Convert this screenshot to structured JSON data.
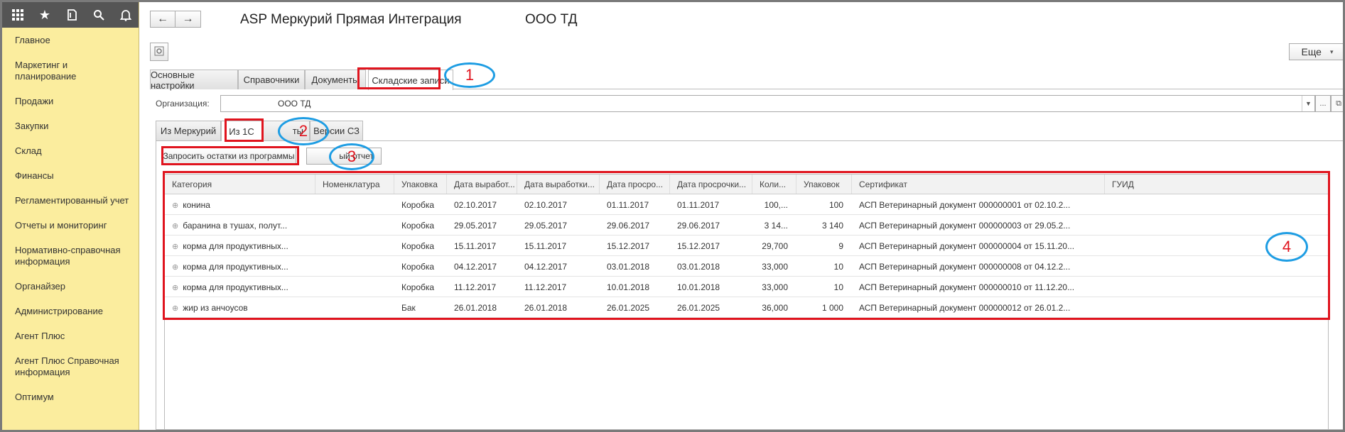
{
  "sidebar": {
    "top_icons": [
      "apps-grid-icon",
      "star-icon",
      "history-icon",
      "search-icon",
      "bell-icon"
    ],
    "items": [
      {
        "label": "Главное"
      },
      {
        "label": "Маркетинг и планирование"
      },
      {
        "label": "Продажи"
      },
      {
        "label": "Закупки"
      },
      {
        "label": "Склад"
      },
      {
        "label": "Финансы"
      },
      {
        "label": "Регламентированный учет"
      },
      {
        "label": "Отчеты и мониторинг"
      },
      {
        "label": "Нормативно-справочная информация"
      },
      {
        "label": "Органайзер"
      },
      {
        "label": "Администрирование"
      },
      {
        "label": "Агент Плюс"
      },
      {
        "label": "Агент Плюс Справочная информация"
      },
      {
        "label": "Оптимум"
      }
    ]
  },
  "header": {
    "title": "ASP Меркурий Прямая Интеграция",
    "org_title": "ООО ТД",
    "more_label": "Еще"
  },
  "tabs_main": [
    {
      "label": "Основные настройки"
    },
    {
      "label": "Справочники"
    },
    {
      "label": "Документы"
    },
    {
      "label": "Складские записи"
    }
  ],
  "org": {
    "label": "Организация:",
    "value": "ООО ТД"
  },
  "tabs_sub": [
    {
      "label": "Из Меркурий"
    },
    {
      "label": "Из 1С"
    },
    {
      "label": "ты"
    },
    {
      "label": "Версии СЗ"
    }
  ],
  "actions": {
    "request_label": "Запросить остатки из программы",
    "report_label": "ый отчет"
  },
  "table": {
    "columns": [
      "Категория",
      "Номенклатура",
      "Упаковка",
      "Дата выработ...",
      "Дата выработки...",
      "Дата просро...",
      "Дата просрочки...",
      "Коли...",
      "Упаковок",
      "Сертификат",
      "ГУИД"
    ],
    "rows": [
      [
        "конина",
        "",
        "Коробка",
        "02.10.2017",
        "02.10.2017",
        "01.11.2017",
        "01.11.2017",
        "100,...",
        "100",
        "АСП Ветеринарный документ 000000001 от 02.10.2...",
        ""
      ],
      [
        "баранина в тушах, полут...",
        "",
        "Коробка",
        "29.05.2017",
        "29.05.2017",
        "29.06.2017",
        "29.06.2017",
        "3 14...",
        "3 140",
        "АСП Ветеринарный документ 000000003 от 29.05.2...",
        ""
      ],
      [
        "корма для продуктивных...",
        "",
        "Коробка",
        "15.11.2017",
        "15.11.2017",
        "15.12.2017",
        "15.12.2017",
        "29,700",
        "9",
        "АСП Ветеринарный документ 000000004 от 15.11.20...",
        ""
      ],
      [
        "корма для продуктивных...",
        "",
        "Коробка",
        "04.12.2017",
        "04.12.2017",
        "03.01.2018",
        "03.01.2018",
        "33,000",
        "10",
        "АСП Ветеринарный документ 000000008 от 04.12.2...",
        ""
      ],
      [
        "корма для продуктивных...",
        "",
        "Коробка",
        "11.12.2017",
        "11.12.2017",
        "10.01.2018",
        "10.01.2018",
        "33,000",
        "10",
        "АСП Ветеринарный документ 000000010 от 11.12.20...",
        ""
      ],
      [
        "жир из анчоусов",
        "",
        "Бак",
        "26.01.2018",
        "26.01.2018",
        "26.01.2025",
        "26.01.2025",
        "36,000",
        "1 000",
        "АСП Ветеринарный документ 000000012 от 26.01.2...",
        ""
      ]
    ]
  },
  "annotations": [
    "1",
    "2",
    "3",
    "4"
  ],
  "colors": {
    "sidebar_bg": "#fbed9e",
    "annotation_red": "#e0141e",
    "annotation_blue": "#1e9de3"
  }
}
